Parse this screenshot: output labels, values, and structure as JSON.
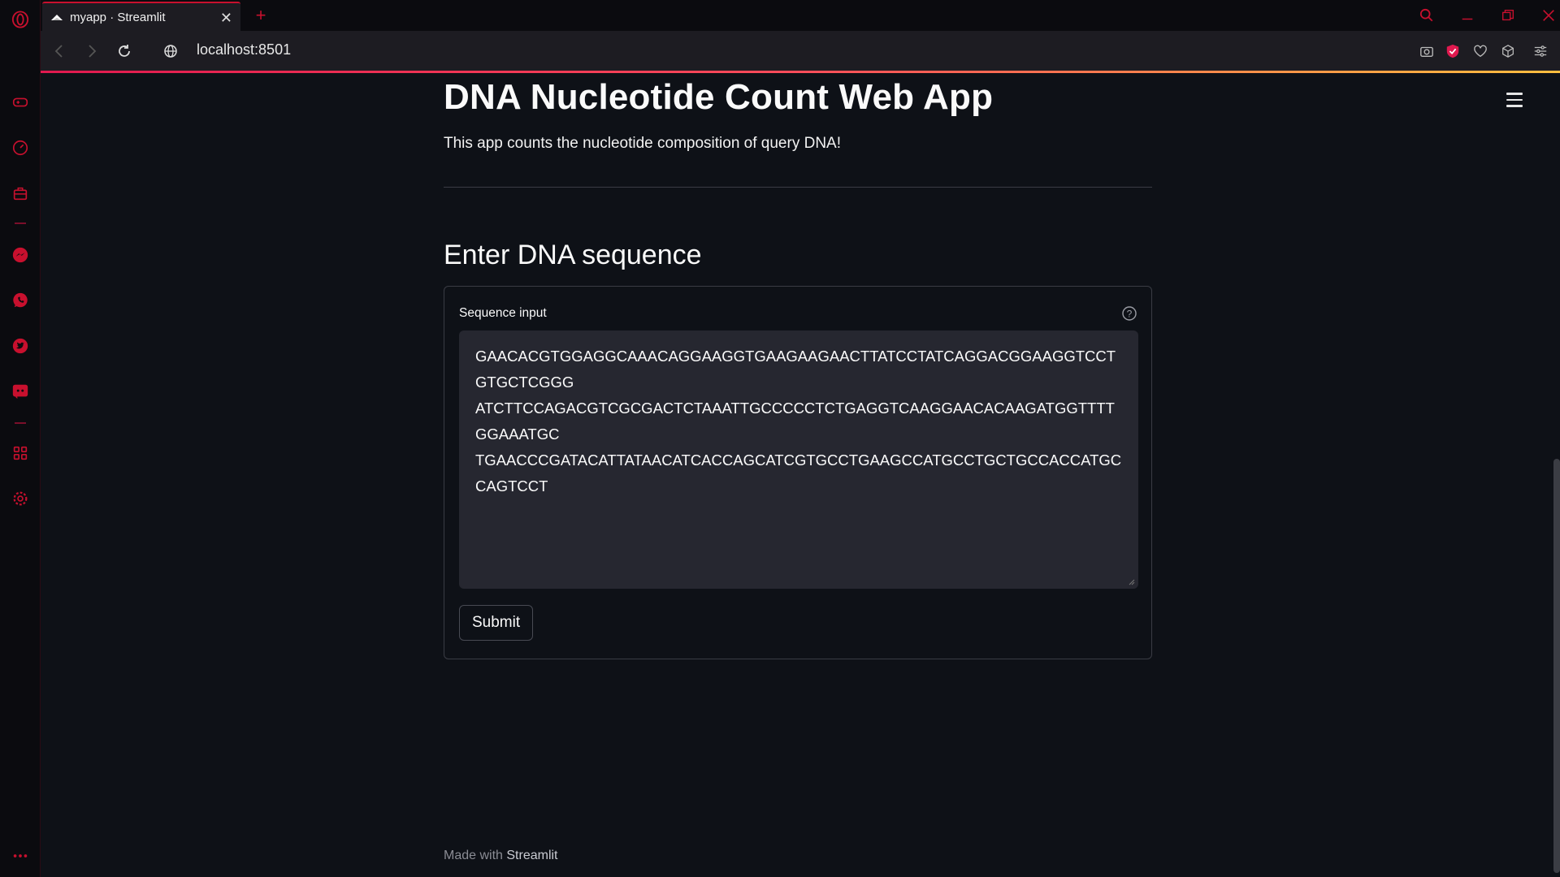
{
  "browser": {
    "tab_title": "myapp · Streamlit",
    "url": "localhost:8501",
    "accent": "#c8102e"
  },
  "sidebar_icons": [
    "opera-logo-icon",
    "gamepad-icon",
    "speedometer-icon",
    "briefcase-icon",
    "messenger-icon",
    "whatsapp-icon",
    "twitter-icon",
    "discord-icon",
    "grid-icon",
    "settings-icon",
    "more-icon"
  ],
  "app": {
    "title": "DNA Nucleotide Count Web App",
    "description": "This app counts the nucleotide composition of query DNA!",
    "section_title": "Enter DNA sequence",
    "input_label": "Sequence input",
    "sequence": "GAACACGTGGAGGCAAACAGGAAGGTGAAGAAGAACTTATCCTATCAGGACGGAAGGTCCTGTGCTCGGG\nATCTTCCAGACGTCGCGACTCTAAATTGCCCCCTCTGAGGTCAAGGAACACAAGATGGTTTTGGAAATGC\nTGAACCCGATACATTATAACATCACCAGCATCGTGCCTGAAGCCATGCCTGCTGCCACCATGCCAGTCCT",
    "submit_label": "Submit",
    "footer_prefix": "Made with ",
    "footer_brand": "Streamlit"
  }
}
